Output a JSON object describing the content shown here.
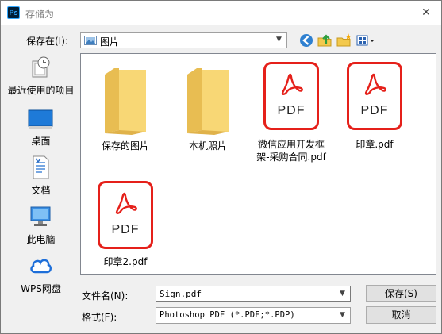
{
  "window": {
    "title": "存储为",
    "app_icon_text": "Ps",
    "close_glyph": "✕"
  },
  "location": {
    "label": "保存在(I):",
    "current": "图片"
  },
  "places": [
    {
      "label": "最近使用的项目",
      "icon": "recent-items-icon"
    },
    {
      "label": "桌面",
      "icon": "desktop-icon"
    },
    {
      "label": "文档",
      "icon": "documents-icon"
    },
    {
      "label": "此电脑",
      "icon": "this-pc-icon"
    },
    {
      "label": "WPS网盘",
      "icon": "wps-cloud-icon"
    }
  ],
  "files": [
    {
      "name": "保存的图片",
      "type": "folder"
    },
    {
      "name": "本机照片",
      "type": "folder"
    },
    {
      "name": "微信应用开发框架-采购合同.pdf",
      "type": "pdf",
      "badge": "PDF"
    },
    {
      "name": "印章.pdf",
      "type": "pdf",
      "badge": "PDF"
    },
    {
      "name": "印章2.pdf",
      "type": "pdf",
      "badge": "PDF"
    }
  ],
  "form": {
    "filename_label": "文件名(N):",
    "filename_value": "Sign.pdf",
    "format_label": "格式(F):",
    "format_value": "Photoshop PDF (*.PDF;*.PDP)"
  },
  "buttons": {
    "save": "保存(S)",
    "cancel": "取消"
  },
  "colors": {
    "pdf_red": "#e5201a",
    "folder_yellow": "#f8d775",
    "accent_blue": "#1e6fd9"
  }
}
